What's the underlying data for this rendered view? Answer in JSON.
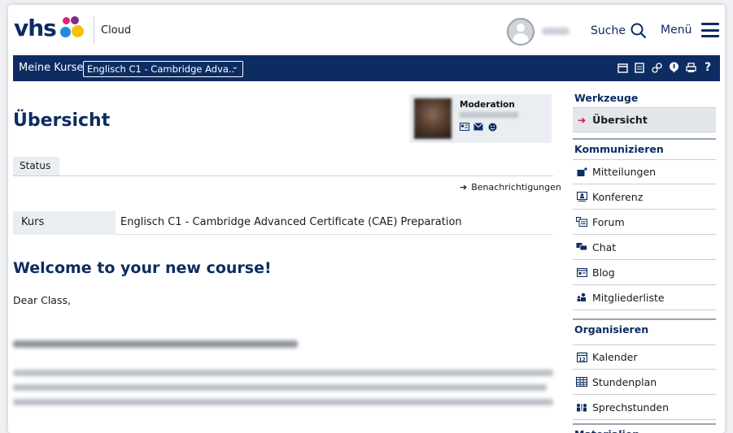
{
  "header": {
    "cloud_label": "Cloud",
    "search_label": "Suche",
    "menu_label": "Menü",
    "logo_text": "vhs"
  },
  "navbar": {
    "my_courses_label": "Meine Kurse",
    "course_selected": "Englisch C1 - Cambridge Adva..",
    "icons": [
      "calendar-icon",
      "notes-icon",
      "link-icon",
      "info-icon",
      "print-icon",
      "help-icon"
    ]
  },
  "main": {
    "title": "Übersicht",
    "moderation": {
      "title": "Moderation",
      "icons": [
        "vcard-icon",
        "mail-icon",
        "smiley-icon"
      ]
    },
    "tab_status": "Status",
    "notifications_link": "Benachrichtigungen",
    "course_row": {
      "key": "Kurs",
      "value": "Englisch C1 - Cambridge Advanced Certificate (CAE) Preparation"
    },
    "welcome_heading": "Welcome to your new course!",
    "greeting": "Dear Class,"
  },
  "sidebar": {
    "sections": [
      {
        "title": "Werkzeuge",
        "items": [
          {
            "label": "Übersicht",
            "icon": "arrow-right-icon",
            "active": true
          }
        ]
      },
      {
        "title": "Kommunizieren",
        "items": [
          {
            "label": "Mitteilungen",
            "icon": "message-icon"
          },
          {
            "label": "Konferenz",
            "icon": "conference-icon"
          },
          {
            "label": "Forum",
            "icon": "forum-icon"
          },
          {
            "label": "Chat",
            "icon": "chat-icon"
          },
          {
            "label": "Blog",
            "icon": "blog-icon"
          },
          {
            "label": "Mitgliederliste",
            "icon": "members-icon"
          }
        ]
      },
      {
        "title": "Organisieren",
        "items": [
          {
            "label": "Kalender",
            "icon": "calendar-icon"
          },
          {
            "label": "Stundenplan",
            "icon": "timetable-icon"
          },
          {
            "label": "Sprechstunden",
            "icon": "office-hours-icon"
          }
        ]
      },
      {
        "title": "Materialien",
        "items": []
      }
    ]
  },
  "colors": {
    "brand_navy": "#0d2c62",
    "accent_red": "#d0103a"
  }
}
